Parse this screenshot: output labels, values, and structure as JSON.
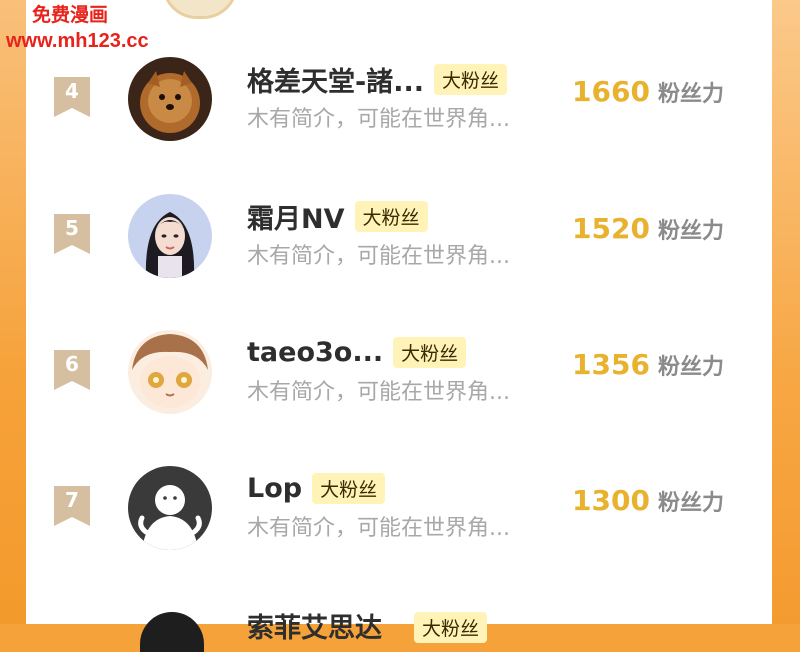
{
  "watermark": {
    "line1": "免费漫画",
    "line2": "www.mh123.cc"
  },
  "rows": [
    {
      "rank": "4",
      "name": "格差天堂-諸...",
      "badge": "大粉丝",
      "bio": "木有简介，可能在世界角...",
      "score": "1660",
      "unit": "粉丝力",
      "avatar_icon": "pomeranian-dog-avatar"
    },
    {
      "rank": "5",
      "name": "霜月NV",
      "badge": "大粉丝",
      "bio": "木有简介，可能在世界角...",
      "score": "1520",
      "unit": "粉丝力",
      "avatar_icon": "girl-portrait-avatar"
    },
    {
      "rank": "6",
      "name": "taeo3o...",
      "badge": "大粉丝",
      "bio": "木有简介，可能在世界角...",
      "score": "1356",
      "unit": "粉丝力",
      "avatar_icon": "anime-character-avatar"
    },
    {
      "rank": "7",
      "name": "Lop",
      "badge": "大粉丝",
      "bio": "木有简介，可能在世界角...",
      "score": "1300",
      "unit": "粉丝力",
      "avatar_icon": "default-ghost-avatar"
    }
  ],
  "partial": {
    "name": "索菲艾思达",
    "badge": "大粉丝"
  },
  "colors": {
    "background": "#f6a23a",
    "score": "#e8b22e",
    "badge_bg": "#fff3b8",
    "rank_tag": "#d6bfa1",
    "watermark": "#e8231b"
  }
}
